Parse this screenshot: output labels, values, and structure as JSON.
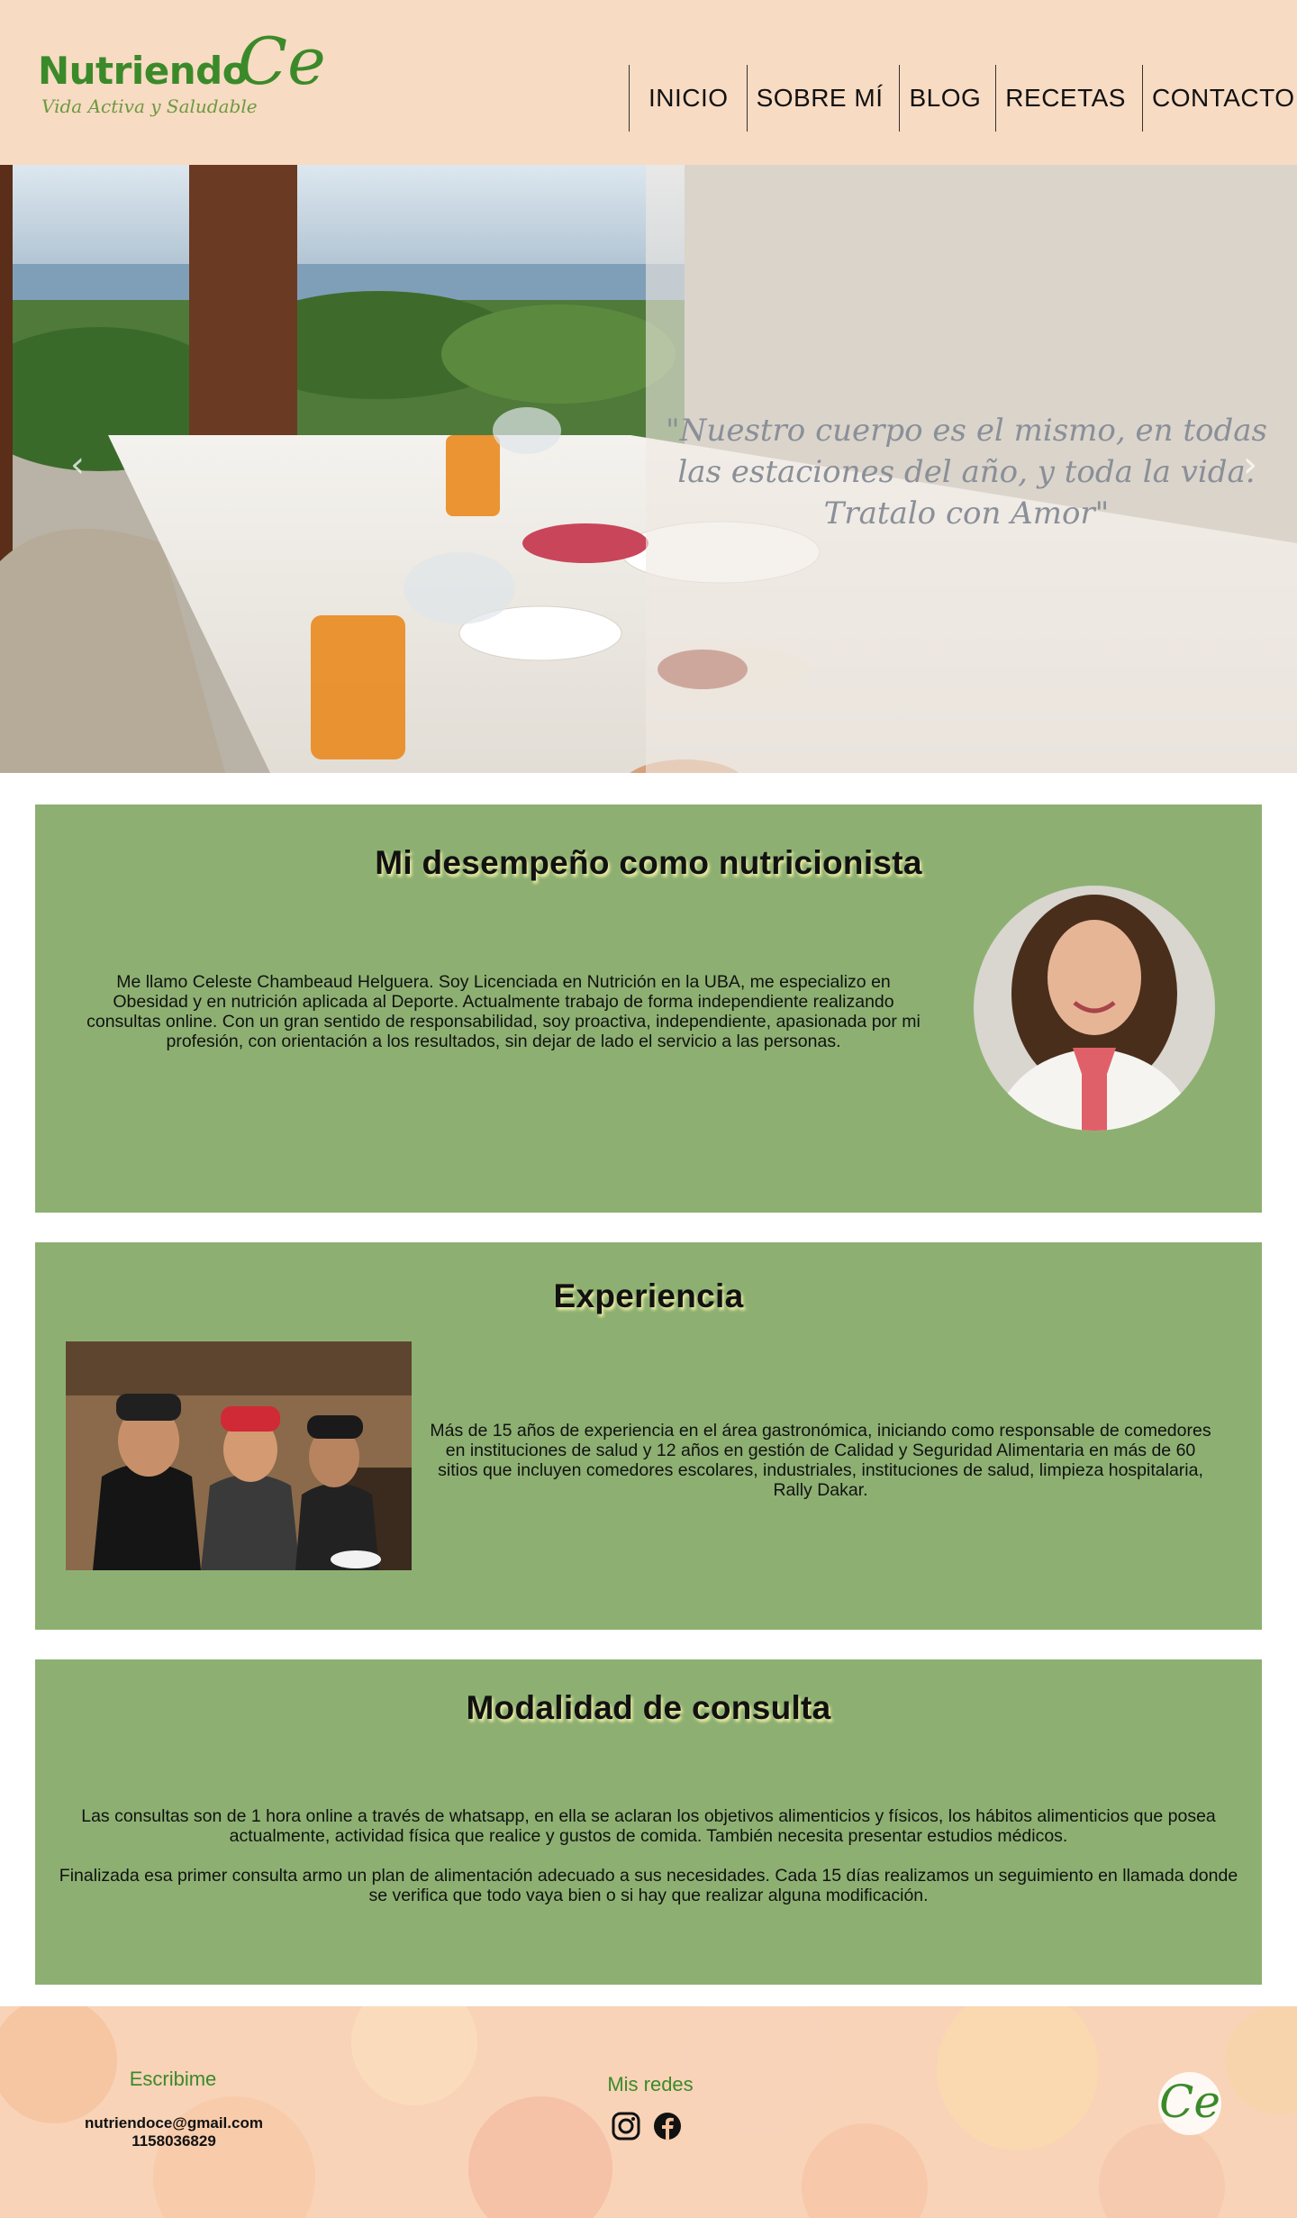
{
  "header": {
    "logo": {
      "name": "Nutriendo",
      "mark": "Ce",
      "tagline": "Vida Activa y Saludable"
    },
    "nav": [
      {
        "label": "INICIO"
      },
      {
        "label": "SOBRE MÍ"
      },
      {
        "label": "BLOG"
      },
      {
        "label": "RECETAS"
      },
      {
        "label": "CONTACTO"
      }
    ]
  },
  "hero": {
    "quote": "\"Nuestro cuerpo es el mismo, en todas las estaciones del año, y toda la vida. Tratalo con Amor\"",
    "prev_icon": "chevron-left-icon",
    "next_icon": "chevron-right-icon"
  },
  "sections": {
    "nutritionist": {
      "title": "Mi desempeño como nutricionista",
      "body": "Me llamo Celeste Chambeaud Helguera. Soy Licenciada en Nutrición en la UBA, me especializo en Obesidad y en nutrición aplicada al Deporte. Actualmente trabajo de forma independiente realizando consultas online. Con un gran sentido de responsabilidad, soy proactiva, independiente, apasionada por mi profesión, con orientación a los resultados, sin dejar de lado el servicio a las personas."
    },
    "experience": {
      "title": "Experiencia",
      "body": "Más de 15 años de experiencia en el área gastronómica, iniciando como responsable de comedores en instituciones de salud y 12 años en gestión de Calidad y Seguridad Alimentaria en más de 60 sitios que incluyen comedores escolares, industriales, instituciones de salud, limpieza hospitalaria, Rally Dakar."
    },
    "consultation": {
      "title": "Modalidad de consulta",
      "paragraph1": "Las consultas son de 1 hora online a través de whatsapp, en ella se aclaran los objetivos alimenticios y físicos, los hábitos alimenticios que posea actualmente, actividad física que realice y gustos de comida. También necesita presentar estudios médicos.",
      "paragraph2": "Finalizada esa primer consulta armo un plan de alimentación adecuado a sus necesidades. Cada 15 días realizamos un seguimiento en llamada donde se verifica que todo vaya bien o si hay que realizar alguna modificación."
    }
  },
  "footer": {
    "write_title": "Escribime",
    "email": "nutriendoce@gmail.com",
    "phone": "1158036829",
    "social_title": "Mis redes",
    "social_icons": [
      "instagram-icon",
      "facebook-icon"
    ],
    "logo_mark": "Ce"
  },
  "colors": {
    "header_bg": "#f8dbc3",
    "section_bg": "#8db072",
    "brand_green": "#3b8a2a",
    "footer_bg": "#f4c49a"
  }
}
